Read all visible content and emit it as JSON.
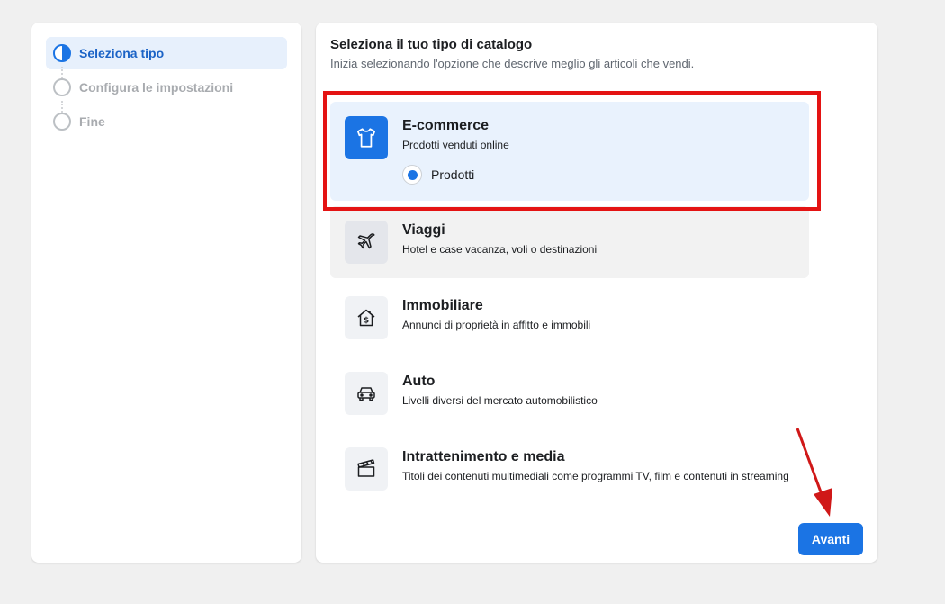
{
  "steps": [
    {
      "label": "Seleziona tipo",
      "state": "current"
    },
    {
      "label": "Configura le impostazioni",
      "state": "pending"
    },
    {
      "label": "Fine",
      "state": "pending"
    }
  ],
  "header": {
    "title": "Seleziona il tuo tipo di catalogo",
    "subtitle": "Inizia selezionando l'opzione che descrive meglio gli articoli che vendi."
  },
  "options": [
    {
      "name": "E-commerce",
      "desc": "Prodotti venduti online",
      "icon": "shirt-icon",
      "selected": true,
      "sub_option": {
        "label": "Prodotti",
        "checked": true
      }
    },
    {
      "name": "Viaggi",
      "desc": "Hotel e case vacanza, voli o destinazioni",
      "icon": "airplane-icon"
    },
    {
      "name": "Immobiliare",
      "desc": "Annunci di proprietà in affitto e immobili",
      "icon": "house-dollar-icon"
    },
    {
      "name": "Auto",
      "desc": "Livelli diversi del mercato automobilistico",
      "icon": "car-icon"
    },
    {
      "name": "Intrattenimento e media",
      "desc": "Titoli dei contenuti multimediali come programmi TV, film e contenuti in streaming",
      "icon": "clapperboard-icon"
    }
  ],
  "footer": {
    "next_label": "Avanti"
  },
  "colors": {
    "accent": "#1b74e4",
    "annotation": "#e41313",
    "selected_bg": "#e9f2fd"
  }
}
